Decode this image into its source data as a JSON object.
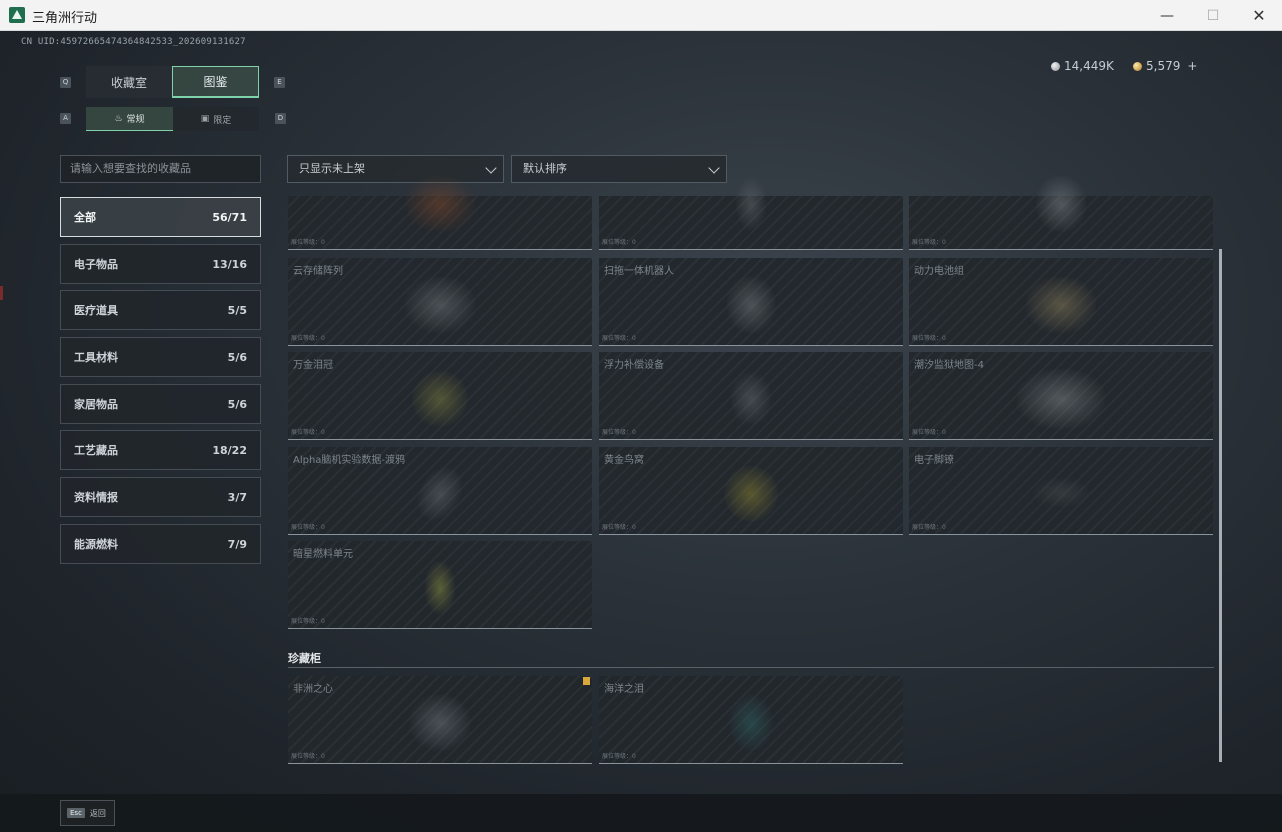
{
  "window": {
    "title": "三角洲行动",
    "icon": "delta-logo-icon"
  },
  "header": {
    "uid": "CN UID:45972665474364842533_202609131627",
    "currency": [
      {
        "icon": "silver-coin-icon",
        "value": "14,449K",
        "color": "#d0d4d8"
      },
      {
        "icon": "gold-coin-icon",
        "value": "5,579",
        "suffix": "+",
        "color": "#d9a83a"
      }
    ]
  },
  "tabs": {
    "key_left": "Q",
    "key_right": "E",
    "main": [
      {
        "label": "收藏室",
        "active": false
      },
      {
        "label": "图鉴",
        "active": true
      }
    ],
    "sub_key_left": "A",
    "sub_key_right": "D",
    "sub": [
      {
        "label": "常规",
        "icon": "flame-icon",
        "active": true
      },
      {
        "label": "限定",
        "icon": "image-icon",
        "active": false
      }
    ]
  },
  "search": {
    "placeholder": "请输入想要查找的收藏品"
  },
  "filters": {
    "display": "只显示未上架",
    "sort": "默认排序"
  },
  "categories": [
    {
      "label": "全部",
      "count": "56/71",
      "active": true
    },
    {
      "label": "电子物品",
      "count": "13/16"
    },
    {
      "label": "医疗道具",
      "count": "5/5"
    },
    {
      "label": "工具材料",
      "count": "5/6"
    },
    {
      "label": "家居物品",
      "count": "5/6"
    },
    {
      "label": "工艺藏品",
      "count": "18/22"
    },
    {
      "label": "资料情报",
      "count": "3/7"
    },
    {
      "label": "能源燃料",
      "count": "7/9"
    }
  ],
  "level_label": "展位等级：0",
  "items": [
    {
      "name": "",
      "art_color": "#8a4a2a"
    },
    {
      "name": "",
      "art_color": "#6b7075"
    },
    {
      "name": "",
      "art_color": "#8a8f94"
    },
    {
      "name": "云存储阵列",
      "art_color": "#7b8085"
    },
    {
      "name": "扫拖一体机器人",
      "art_color": "#7d8287"
    },
    {
      "name": "动力电池组",
      "art_color": "#9a8a60"
    },
    {
      "name": "万金泪冠",
      "art_color": "#8a8a40"
    },
    {
      "name": "浮力补偿设备",
      "art_color": "#6a7075"
    },
    {
      "name": "潮汐监狱地图-4",
      "art_color": "#8d9196"
    },
    {
      "name": "Alpha脑机实验数据-渡鸦",
      "art_color": "#6e747a"
    },
    {
      "name": "黄金鸟窝",
      "art_color": "#9a9030"
    },
    {
      "name": "电子脚镣",
      "art_color": "#4a4f54"
    },
    {
      "name": "暗星燃料单元",
      "art_color": "#9aa040"
    }
  ],
  "showcase": {
    "title": "珍藏柜",
    "items": [
      {
        "name": "非洲之心",
        "art_color": "#7a8085",
        "badge": true
      },
      {
        "name": "海洋之泪",
        "art_color": "#2f6a6a",
        "badge": false
      }
    ]
  },
  "footer": {
    "key": "Esc",
    "label": "返回"
  }
}
